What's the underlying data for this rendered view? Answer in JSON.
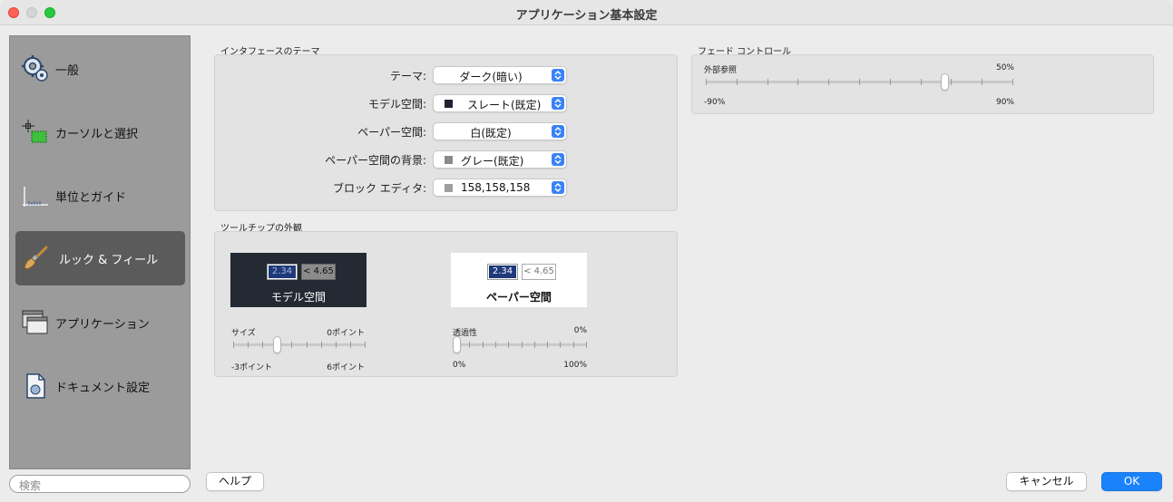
{
  "window": {
    "title": "アプリケーション基本設定"
  },
  "sidebar": {
    "items": [
      {
        "label": "一般",
        "icon": "gears-icon"
      },
      {
        "label": "カーソルと選択",
        "icon": "cursor-selection-icon"
      },
      {
        "label": "単位とガイド",
        "icon": "ruler-icon"
      },
      {
        "label": "ルック & フィール",
        "icon": "brush-icon",
        "selected": true
      },
      {
        "label": "アプリケーション",
        "icon": "windows-icon"
      },
      {
        "label": "ドキュメント設定",
        "icon": "document-icon"
      }
    ],
    "search_placeholder": "検索"
  },
  "theme_group": {
    "title": "インタフェースのテーマ",
    "rows": [
      {
        "label": "テーマ:",
        "value": "ダーク(暗い)"
      },
      {
        "label": "モデル空間:",
        "value": "スレート(既定)",
        "swatch": "#1f2430"
      },
      {
        "label": "ペーパー空間:",
        "value": "白(既定)"
      },
      {
        "label": "ペーパー空間の背景:",
        "value": "グレー(既定)",
        "swatch": "#8a8a8a"
      },
      {
        "label": "ブロック エディタ:",
        "value": "158,158,158",
        "swatch": "#9e9e9e"
      }
    ]
  },
  "tooltip_group": {
    "title": "ツールチップの外観",
    "model_preview": {
      "value1": "2.34",
      "value2": "< 4.65",
      "caption": "モデル空間"
    },
    "paper_preview": {
      "value1": "2.34",
      "value2": "< 4.65",
      "caption": "ペーパー空間"
    },
    "size_slider": {
      "label": "サイズ",
      "value_label": "0ポイント",
      "min_label": "-3ポイント",
      "max_label": "6ポイント",
      "min": -3,
      "max": 6,
      "value": 0
    },
    "transparency_slider": {
      "label": "透過性",
      "value_label": "0%",
      "min_label": "0%",
      "max_label": "100%",
      "min": 0,
      "max": 100,
      "value": 0
    }
  },
  "fade_group": {
    "title": "フェード コントロール",
    "xref_slider": {
      "label": "外部参照",
      "value_label": "50%",
      "min_label": "-90%",
      "max_label": "90%",
      "min": -90,
      "max": 90,
      "value": 50
    }
  },
  "buttons": {
    "help": "ヘルプ",
    "cancel": "キャンセル",
    "ok": "OK"
  },
  "colors": {
    "accent": "#1a82fb",
    "sidebar_bg": "#9b9b9b",
    "sidebar_selected": "#5b5b5b",
    "model_space_bg": "#232a33",
    "paper_space_bg": "#ffffff"
  }
}
